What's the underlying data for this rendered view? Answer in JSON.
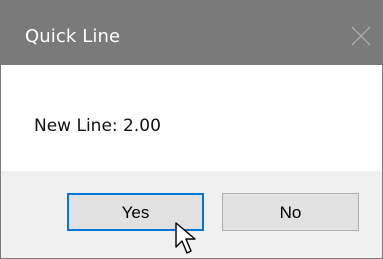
{
  "dialog": {
    "title": "Quick Line",
    "message": "New Line: 2.00",
    "buttons": {
      "yes_label": "Yes",
      "no_label": "No"
    },
    "title_bar_color": "#7a7a7a",
    "focus_color": "#0078d7"
  },
  "icons": {
    "close": "close-icon",
    "cursor": "mouse-cursor-icon"
  }
}
